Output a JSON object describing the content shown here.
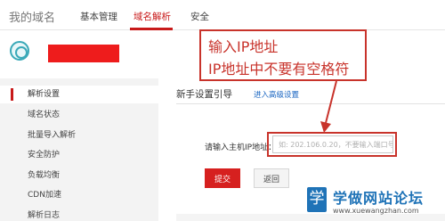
{
  "topnav": {
    "brand": "我的域名",
    "tabs": [
      {
        "label": "基本管理",
        "active": false
      },
      {
        "label": "域名解析",
        "active": true
      },
      {
        "label": "安全",
        "active": false
      }
    ]
  },
  "sidebar": {
    "items": [
      {
        "label": "解析设置",
        "active": true
      },
      {
        "label": "域名状态",
        "active": false
      },
      {
        "label": "批量导入解析",
        "active": false
      },
      {
        "label": "安全防护",
        "active": false
      },
      {
        "label": "负载均衡",
        "active": false
      },
      {
        "label": "CDN加速",
        "active": false
      },
      {
        "label": "解析日志",
        "active": false
      }
    ]
  },
  "main": {
    "guide_title": "新手设置引导",
    "advanced_link": "进入高级设置",
    "ip_label": "请输入主机IP地址：",
    "ip_placeholder": "如: 202.106.0.20，不要输入端口号",
    "submit_label": "提交",
    "back_label": "返回"
  },
  "annotation": {
    "line1": "输入IP地址",
    "line2": "IP地址中不要有空格符",
    "color": "#c8332b"
  },
  "watermark": {
    "icon_char": "学",
    "text": "学做网站论坛",
    "url": "www.xuewangzhan.com"
  },
  "colors": {
    "accent": "#c81a1a",
    "redacted_block": "#ee1c1c",
    "link": "#1a66c2",
    "watermark_blue": "#1f73b7"
  }
}
